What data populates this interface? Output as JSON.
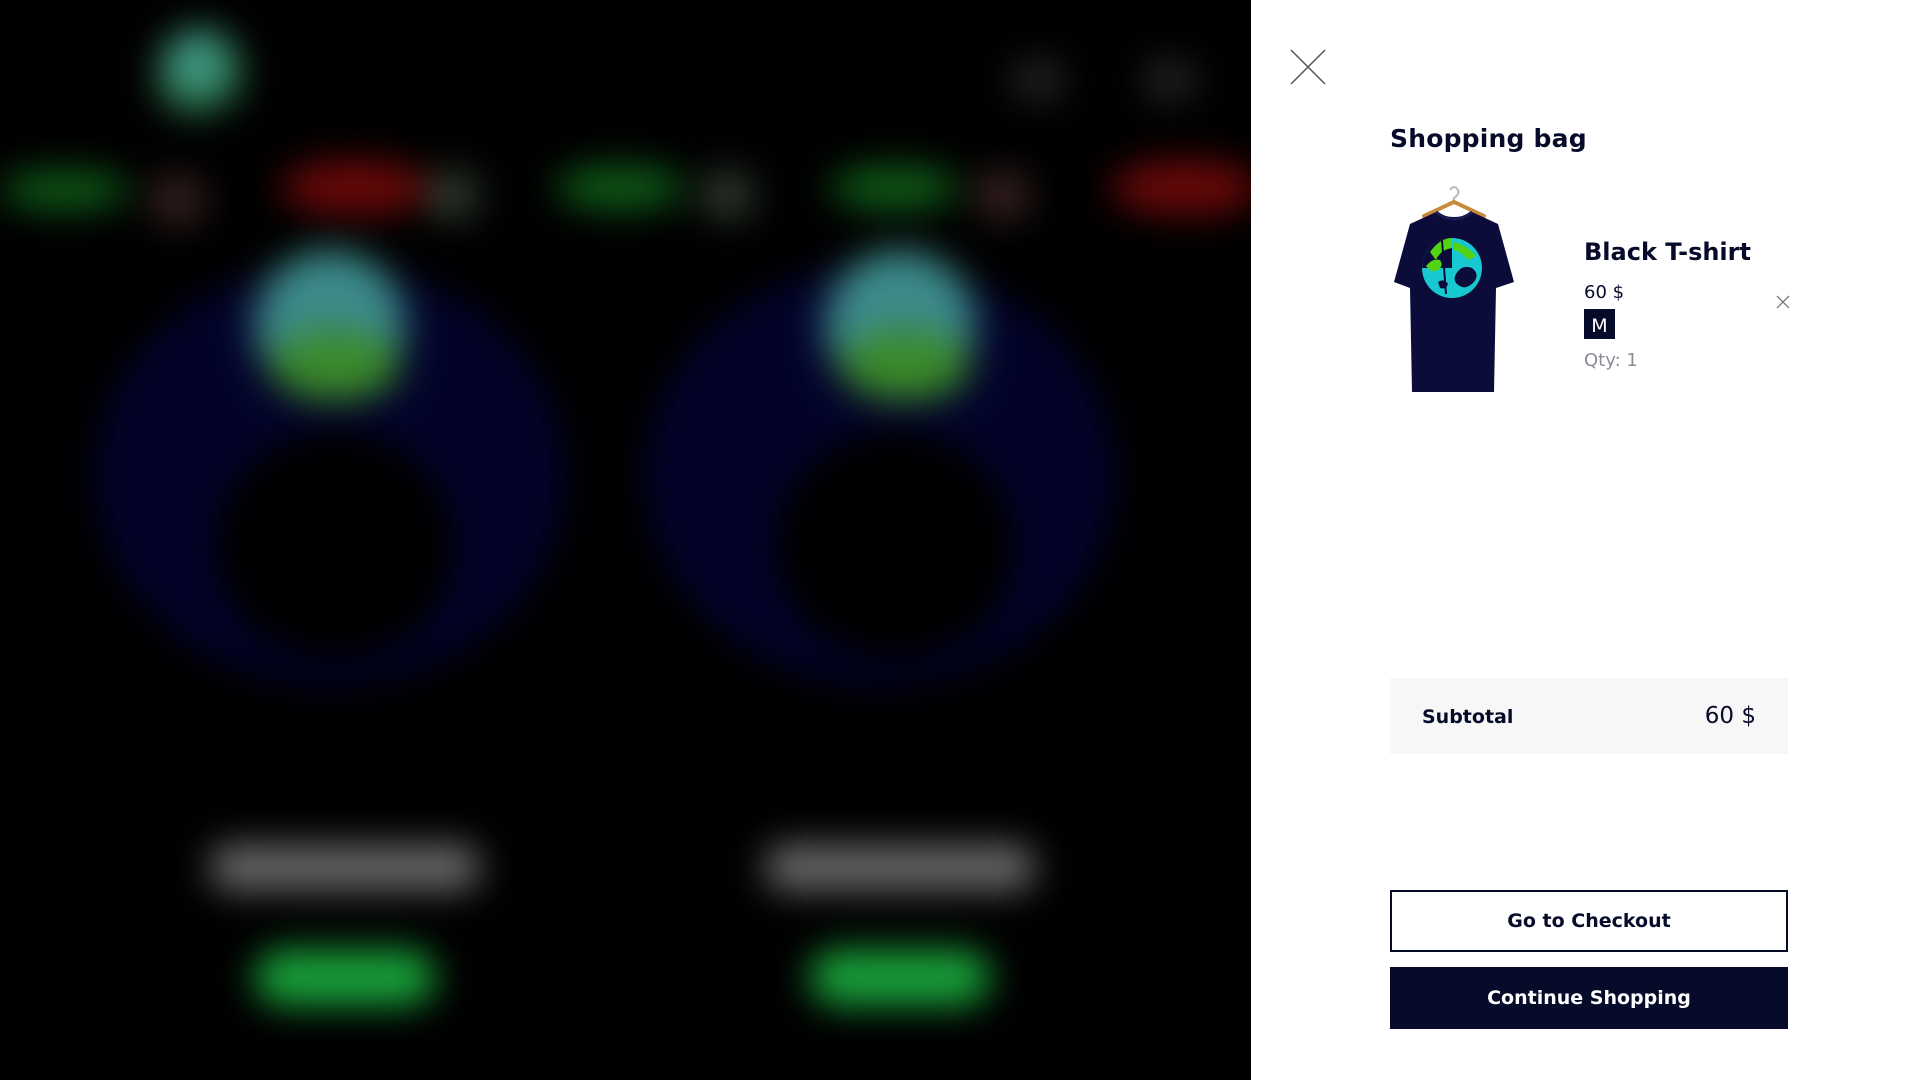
{
  "drawer": {
    "title": "Shopping bag",
    "close_icon": "close-icon"
  },
  "cart": {
    "items": [
      {
        "name": "Black T-shirt",
        "price": "60 $",
        "size": "M",
        "qty": "Qty: 1",
        "image_icon": "tshirt-image",
        "remove_icon": "remove-icon"
      }
    ],
    "subtotal_label": "Subtotal",
    "subtotal_value": "60 $"
  },
  "actions": {
    "checkout_label": "Go to Checkout",
    "continue_label": "Continue Shopping"
  },
  "colors": {
    "navy": "#070b2a",
    "subtotal_bg": "#f7f7f7",
    "muted": "#8a8c95"
  }
}
